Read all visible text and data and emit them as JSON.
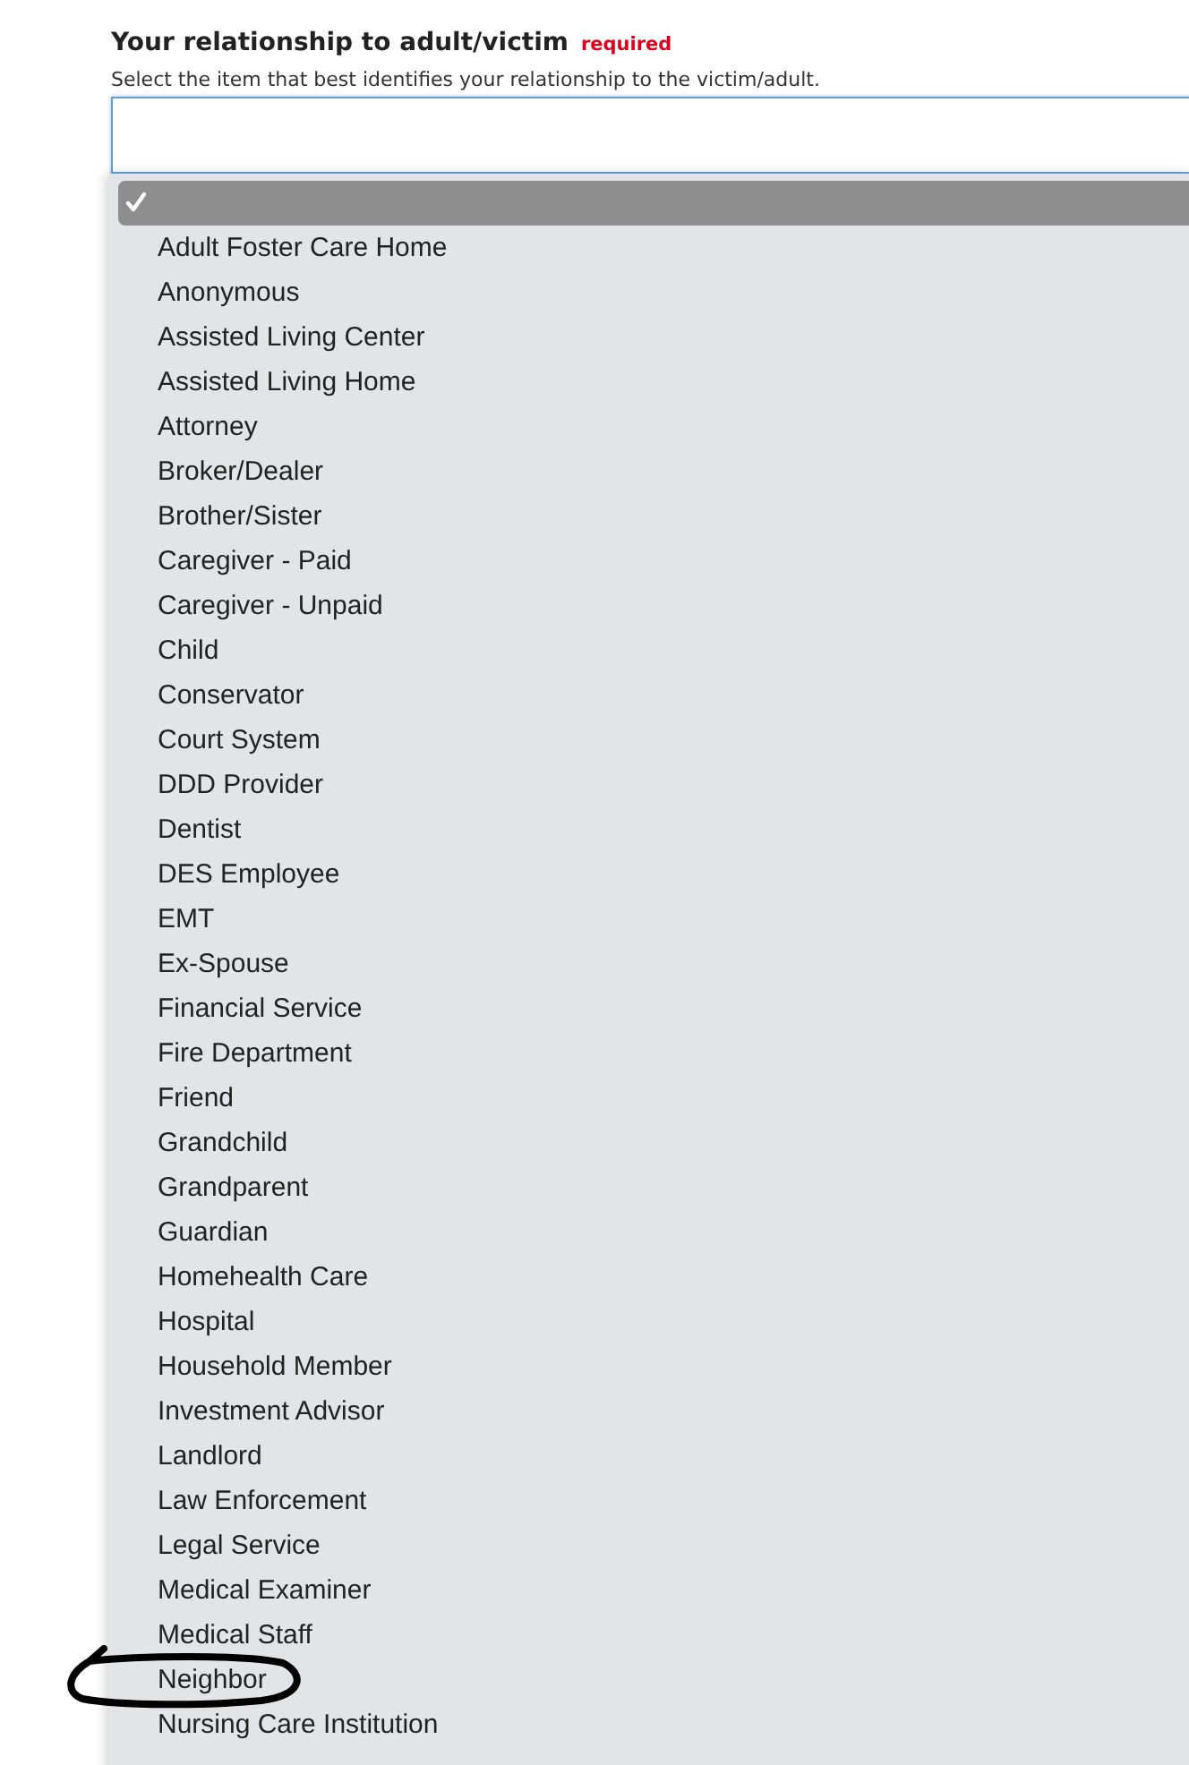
{
  "field": {
    "label": "Your relationship to adult/victim",
    "required": "required",
    "description": "Select the item that best identifies your relationship to the victim/adult."
  },
  "options": [
    {
      "selected": true
    },
    {
      "label": "Adult Foster Care Home",
      "selected": false
    },
    {
      "label": "Anonymous",
      "selected": false
    },
    {
      "label": "Assisted Living Center",
      "selected": false
    },
    {
      "label": "Assisted Living Home",
      "selected": false
    },
    {
      "label": "Attorney",
      "selected": false
    },
    {
      "label": "Broker/Dealer",
      "selected": false
    },
    {
      "label": "Brother/Sister",
      "selected": false
    },
    {
      "label": "Caregiver - Paid",
      "selected": false
    },
    {
      "label": "Caregiver - Unpaid",
      "selected": false
    },
    {
      "label": "Child",
      "selected": false
    },
    {
      "label": "Conservator",
      "selected": false
    },
    {
      "label": "Court System",
      "selected": false
    },
    {
      "label": "DDD Provider",
      "selected": false
    },
    {
      "label": "Dentist",
      "selected": false
    },
    {
      "label": "DES Employee",
      "selected": false
    },
    {
      "label": "EMT",
      "selected": false
    },
    {
      "label": "Ex-Spouse",
      "selected": false
    },
    {
      "label": "Financial Service",
      "selected": false
    },
    {
      "label": "Fire Department",
      "selected": false
    },
    {
      "label": "Friend",
      "selected": false
    },
    {
      "label": "Grandchild",
      "selected": false
    },
    {
      "label": "Grandparent",
      "selected": false
    },
    {
      "label": "Guardian",
      "selected": false
    },
    {
      "label": "Homehealth Care",
      "selected": false
    },
    {
      "label": "Hospital",
      "selected": false
    },
    {
      "label": "Household Member",
      "selected": false
    },
    {
      "label": "Investment Advisor",
      "selected": false
    },
    {
      "label": "Landlord",
      "selected": false
    },
    {
      "label": "Law Enforcement",
      "selected": false
    },
    {
      "label": "Legal Service",
      "selected": false
    },
    {
      "label": "Medical Examiner",
      "selected": false
    },
    {
      "label": "Medical Staff",
      "selected": false
    },
    {
      "label": "Neighbor",
      "selected": false,
      "circled": true
    },
    {
      "label": "Nursing Care Institution",
      "selected": false
    }
  ]
}
